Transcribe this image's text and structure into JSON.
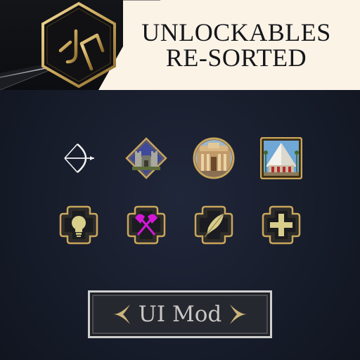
{
  "header": {
    "title_line1": "UNLOCKABLES",
    "title_line2": "RE-SORTED",
    "logo_icon": "jn-monogram-logo"
  },
  "icons_row1": [
    {
      "name": "bow-icon"
    },
    {
      "name": "fortress-icon"
    },
    {
      "name": "palace-icon"
    },
    {
      "name": "pyramid-icon"
    }
  ],
  "icons_row2": [
    {
      "name": "lightbulb-icon",
      "color": "#d9cf8a"
    },
    {
      "name": "crossed-axes-icon",
      "color": "#d418d8"
    },
    {
      "name": "feather-quill-icon",
      "color": "#d8cd8a"
    },
    {
      "name": "plus-icon",
      "color": "#d8cd8a"
    }
  ],
  "footer": {
    "button_label": "UI Mod"
  },
  "colors": {
    "gold": "#c9a65a",
    "banner": "#fbf3e6",
    "background": "#171c2a"
  }
}
